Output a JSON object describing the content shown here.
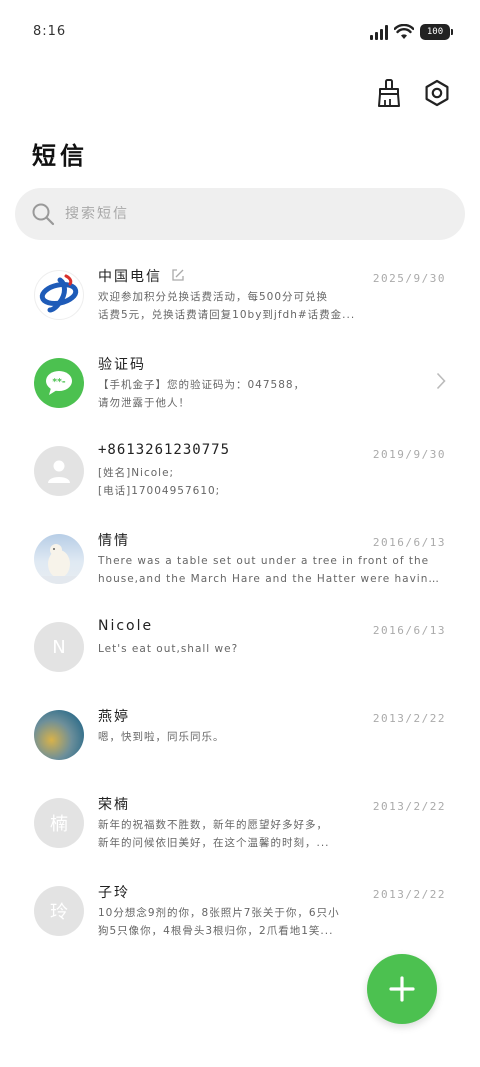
{
  "status": {
    "time": "8:16",
    "battery": "100"
  },
  "header": {
    "title": "短信"
  },
  "search": {
    "placeholder": "搜索短信"
  },
  "conversations": [
    {
      "name": "中国电信",
      "date": "2025/9/30",
      "line1": "欢迎参加积分兑换话费活动，每500分可兑换",
      "line2": "话费5元，兑换话费请回复10by到jfdh#话费金...",
      "avatar": "china-telecom-logo"
    },
    {
      "name": "验证码",
      "date": "",
      "line1": "【手机金子】您的验证码为：047588，",
      "line2": "请勿泄露于他人！",
      "avatar": "message-bubble-icon"
    },
    {
      "name": "+8613261230775",
      "date": "2019/9/30",
      "line1": "[姓名]Nicole;",
      "line2": "[电话]17004957610;",
      "avatar": "person-icon"
    },
    {
      "name": "情情",
      "date": "2016/6/13",
      "line1": "There was a table set out under a tree in front of the",
      "line2": "house,and the March Hare and the Hatter were having tea at...",
      "avatar": "polar-bear-photo"
    },
    {
      "name": "Nicole",
      "date": "2016/6/13",
      "line1": "Let's eat out,shall we?",
      "line2": "",
      "avatar": "N"
    },
    {
      "name": "燕婷",
      "date": "2013/2/22",
      "line1": "嗯，快到啦，同乐同乐。",
      "line2": "",
      "avatar": "landscape-photo"
    },
    {
      "name": "荣楠",
      "date": "2013/2/22",
      "line1": "新年的祝福数不胜数，新年的愿望好多好多，",
      "line2": "新年的问候依旧美好，在这个温馨的时刻，...",
      "avatar": "楠"
    },
    {
      "name": "子玲",
      "date": "2013/2/22",
      "line1": "10分想念9剂的你，8张照片7张关于你，6只小",
      "line2": "狗5只像你，4根骨头3根归你，2爪看地1笑...",
      "avatar": "玲"
    }
  ],
  "colors": {
    "accent": "#4cc150",
    "telecom_blue": "#1e5bb8",
    "telecom_red": "#d9302c"
  }
}
